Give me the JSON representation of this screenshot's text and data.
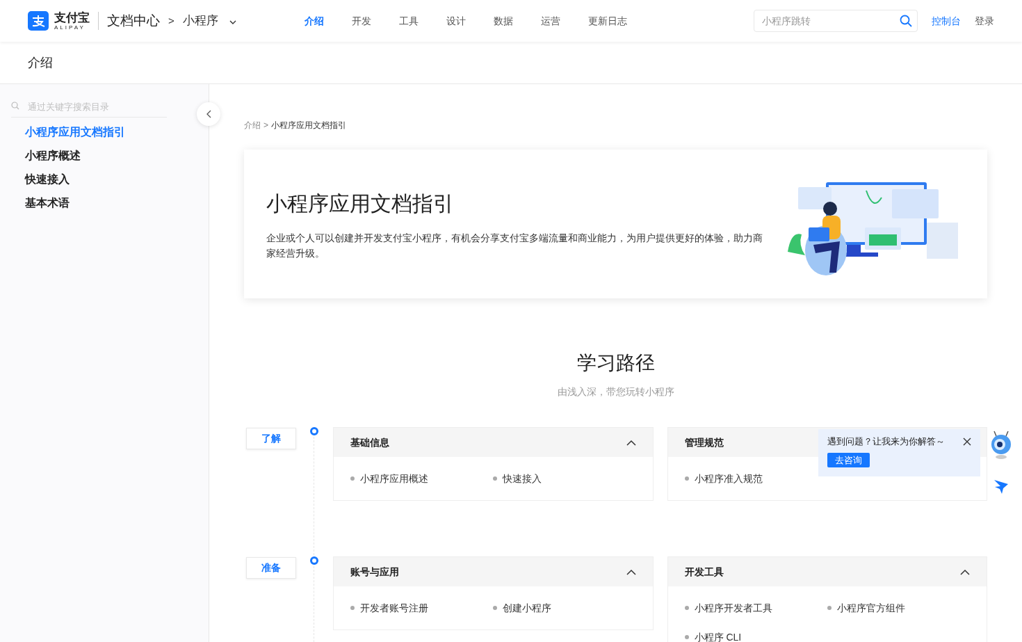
{
  "header": {
    "logo": {
      "name": "支付宝",
      "sub": "ALIPAY"
    },
    "site": "文档中心",
    "separator": ">",
    "product": "小程序",
    "nav": [
      {
        "label": "介绍",
        "selected": true
      },
      {
        "label": "开发",
        "selected": false
      },
      {
        "label": "工具",
        "selected": false
      },
      {
        "label": "设计",
        "selected": false
      },
      {
        "label": "数据",
        "selected": false
      },
      {
        "label": "运营",
        "selected": false
      },
      {
        "label": "更新日志",
        "selected": false
      }
    ],
    "search": {
      "placeholder": "小程序跳转"
    },
    "links": [
      {
        "label": "控制台",
        "kind": "primary"
      },
      {
        "label": "登录",
        "kind": "plain"
      }
    ]
  },
  "page_title": "介绍",
  "sidebar": {
    "search": {
      "placeholder": "通过关键字搜索目录"
    },
    "items": [
      {
        "label": "小程序应用文档指引",
        "selected": true
      },
      {
        "label": "小程序概述",
        "selected": false
      },
      {
        "label": "快速接入",
        "selected": false
      },
      {
        "label": "基本术语",
        "selected": false
      }
    ]
  },
  "breadcrumb": {
    "items": [
      "介绍",
      "小程序应用文档指引"
    ],
    "separator": ">"
  },
  "hero": {
    "title": "小程序应用文档指引",
    "description": "企业或个人可以创建并开发支付宝小程序，有机会分享支付宝多端流量和商业能力，为用户提供更好的体验，助力商家经营升级。"
  },
  "learning_path": {
    "title": "学习路径",
    "subtitle": "由浅入深，带您玩转小程序",
    "stages": [
      {
        "tag": "了解",
        "cards": [
          {
            "title": "基础信息",
            "expanded": true,
            "show_toggle": true,
            "links": [
              "小程序应用概述",
              "快速接入"
            ]
          },
          {
            "title": "管理规范",
            "expanded": true,
            "show_toggle": false,
            "links": [
              "小程序准入规范"
            ]
          }
        ]
      },
      {
        "tag": "准备",
        "cards": [
          {
            "title": "账号与应用",
            "expanded": true,
            "show_toggle": true,
            "links": [
              "开发者账号注册",
              "创建小程序"
            ]
          },
          {
            "title": "开发工具",
            "expanded": true,
            "show_toggle": true,
            "links": [
              "小程序开发者工具",
              "小程序官方组件",
              "小程序 CLI"
            ]
          }
        ]
      }
    ]
  },
  "chat_popup": {
    "message": "遇到问题？让我来为你解答～",
    "button": "去咨询"
  }
}
